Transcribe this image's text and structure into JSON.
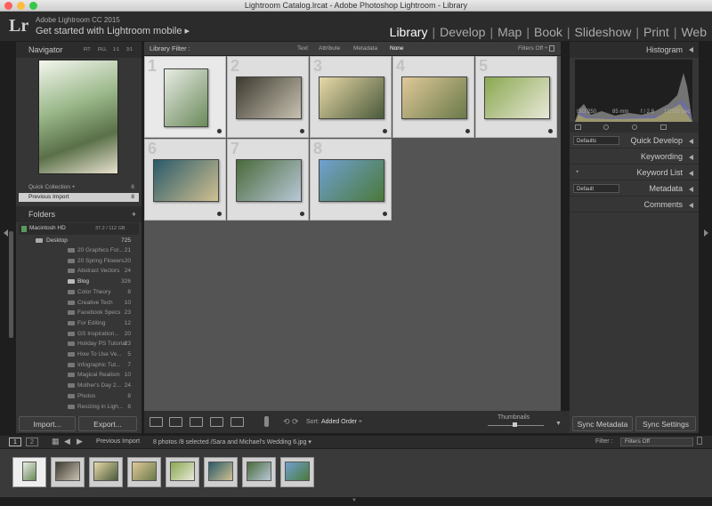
{
  "window": {
    "title": "Lightroom Catalog.lrcat - Adobe Photoshop Lightroom - Library"
  },
  "identity": {
    "logo": "Lr",
    "app_name": "Adobe Lightroom CC 2015",
    "mobile": "Get started with Lightroom mobile ▸"
  },
  "modules": [
    "Library",
    "Develop",
    "Map",
    "Book",
    "Slideshow",
    "Print",
    "Web"
  ],
  "navigator": {
    "title": "Navigator",
    "zoom": [
      "FIT",
      "FILL",
      "1:1",
      "3:1"
    ]
  },
  "catalog": [
    {
      "label": "Quick Collection +",
      "count": "6"
    },
    {
      "label": "Previous Import",
      "count": "8"
    }
  ],
  "folders": {
    "title": "Folders",
    "volume": "Macintosh HD",
    "volume_size": "37.2 / 112 GB",
    "root": {
      "label": "Desktop",
      "count": "725"
    },
    "items": [
      {
        "label": "20 Graphics For...",
        "count": "21"
      },
      {
        "label": "20 Spring Flowers",
        "count": "20"
      },
      {
        "label": "Abstract Vectors",
        "count": "24"
      },
      {
        "label": "Blog",
        "count": "326"
      },
      {
        "label": "Color Theory",
        "count": "8"
      },
      {
        "label": "Creative Tech",
        "count": "10"
      },
      {
        "label": "Facebook Specs",
        "count": "23"
      },
      {
        "label": "For Editing",
        "count": "12"
      },
      {
        "label": "GS Inspiration...",
        "count": "20"
      },
      {
        "label": "Holiday PS Tutorial",
        "count": "23"
      },
      {
        "label": "How To Use Ve...",
        "count": "5"
      },
      {
        "label": "Infographic Tut...",
        "count": "7"
      },
      {
        "label": "Magical Realism",
        "count": "10"
      },
      {
        "label": "Mother's Day 2...",
        "count": "24"
      },
      {
        "label": "Photos",
        "count": "8"
      },
      {
        "label": "Resizing in Ligh...",
        "count": "8"
      }
    ]
  },
  "left_buttons": {
    "import": "Import...",
    "export": "Export..."
  },
  "filter": {
    "title": "Library Filter :",
    "options": [
      "Text",
      "Attribute",
      "Metadata",
      "None"
    ],
    "preset": "Filters Off ÷"
  },
  "grid": [
    {
      "num": "1",
      "c1": "#e8ece4",
      "c2": "#6a8a5a"
    },
    {
      "num": "2",
      "c1": "#3d3a30",
      "c2": "#c8c2b0"
    },
    {
      "num": "3",
      "c1": "#e8d8a8",
      "c2": "#4a5a3a"
    },
    {
      "num": "4",
      "c1": "#e0c898",
      "c2": "#6a7a4a"
    },
    {
      "num": "5",
      "c1": "#8aa850",
      "c2": "#e8e8d8"
    },
    {
      "num": "6",
      "c1": "#2a5a6a",
      "c2": "#d0c090"
    },
    {
      "num": "7",
      "c1": "#4a6a3a",
      "c2": "#b8c8d8"
    },
    {
      "num": "8",
      "c1": "#70a0d0",
      "c2": "#4a7a3a"
    }
  ],
  "toolbar": {
    "sort_label": "Sort:",
    "sort_value": "Added Order ÷",
    "thumbnails": "Thumbnails"
  },
  "histogram": {
    "title": "Histogram",
    "iso": "ISO 250",
    "focal": "85 mm",
    "aperture": "f / 2.8",
    "shutter": "1/2500 sec"
  },
  "right_panels": [
    {
      "preset": "Defaults",
      "label": "Quick Develop"
    },
    {
      "preset": "",
      "label": "Keywording"
    },
    {
      "preset": "+",
      "label": "Keyword List"
    },
    {
      "preset": "Default",
      "label": "Metadata"
    },
    {
      "preset": "",
      "label": "Comments"
    }
  ],
  "right_buttons": {
    "sync_meta": "Sync Metadata",
    "sync_settings": "Sync Settings"
  },
  "filmstrip": {
    "page1": "1",
    "page2": "2",
    "source": "Previous Import",
    "info": "8 photos /8 selected /Sara and Michael's Wedding 6.jpg ▾",
    "filter_label": "Filter :",
    "filter_value": "Filters Off"
  }
}
